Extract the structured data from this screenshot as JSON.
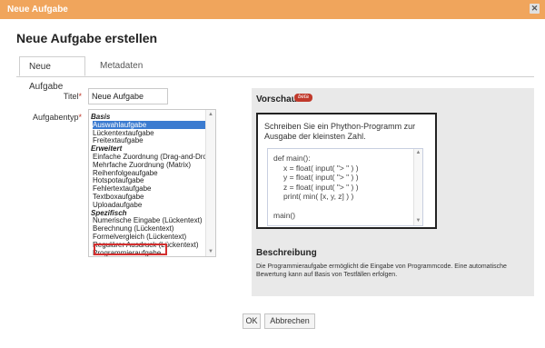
{
  "modal": {
    "title": "Neue Aufgabe",
    "close_glyph": "✕"
  },
  "heading": "Neue Aufgabe erstellen",
  "tabs": [
    {
      "label": "Neue Aufgabe"
    },
    {
      "label": "Metadaten"
    }
  ],
  "form": {
    "title_label": "Titel",
    "title_value": "Neue Aufgabe",
    "type_label": "Aufgabentyp",
    "required_mark": "*",
    "selected": "Programmieraufgabe",
    "items": [
      {
        "label": "Basis",
        "group": true
      },
      {
        "label": "Auswahlaufgabe",
        "group": false
      },
      {
        "label": "Lückentextaufgabe",
        "group": false
      },
      {
        "label": "Freitextaufgabe",
        "group": false
      },
      {
        "label": "Erweitert",
        "group": true
      },
      {
        "label": "Einfache Zuordnung (Drag-and-Drop)",
        "group": false
      },
      {
        "label": "Mehrfache Zuordnung (Matrix)",
        "group": false
      },
      {
        "label": "Reihenfolgeaufgabe",
        "group": false
      },
      {
        "label": "Hotspotaufgabe",
        "group": false
      },
      {
        "label": "Fehlertextaufgabe",
        "group": false
      },
      {
        "label": "Textboxaufgabe",
        "group": false
      },
      {
        "label": "Uploadaufgabe",
        "group": false
      },
      {
        "label": "Spezifisch",
        "group": true
      },
      {
        "label": "Numerische Eingabe (Lückentext)",
        "group": false
      },
      {
        "label": "Berechnung (Lückentext)",
        "group": false
      },
      {
        "label": "Formelvergleich (Lückentext)",
        "group": false
      },
      {
        "label": "Regulärer Ausdruck (Lückentext)",
        "group": false
      },
      {
        "label": "Programmieraufgabe",
        "group": false
      }
    ]
  },
  "preview": {
    "title": "Vorschau",
    "badge": "beta",
    "task_text": "Schreiben Sie ein Phython-Programm zur Ausgabe der kleinsten Zahl.",
    "code_lines": [
      {
        "text": "def main():",
        "indent": false
      },
      {
        "text": "x = float( input( \"> \" ) )",
        "indent": true
      },
      {
        "text": "y = float( input( \"> \" ) )",
        "indent": true
      },
      {
        "text": "z = float( input( \"> \" ) )",
        "indent": true
      },
      {
        "text": "print( min( [x, y, z] ) )",
        "indent": true
      },
      {
        "text": "",
        "indent": false
      },
      {
        "text": "main()",
        "indent": false
      }
    ]
  },
  "description": {
    "title": "Beschreibung",
    "text": "Die Programmieraufgabe ermöglicht die Eingabe von Programmcode. Eine automatische Bewertung kann auf Basis von Testfällen erfolgen."
  },
  "buttons": {
    "ok": "OK",
    "cancel": "Abbrechen"
  },
  "colors": {
    "titlebar": "#f0a55c",
    "selection": "#3b7bd0",
    "highlight": "#d32f2f",
    "badge": "#c0392b"
  }
}
